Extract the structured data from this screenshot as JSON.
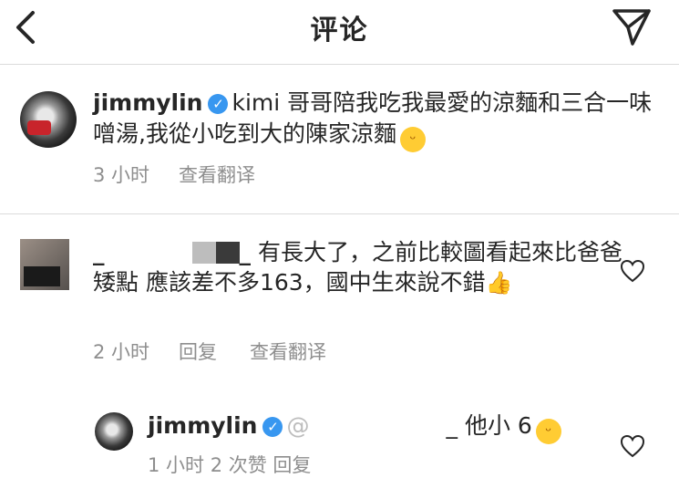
{
  "header": {
    "title": "评论",
    "back_icon": "chevron-left-icon",
    "share_icon": "paper-plane-icon"
  },
  "caption": {
    "username": "jimmylin",
    "text": "kimi 哥哥陪我吃我最愛的涼麵和三合一味噌湯,我從小吃到大的陳家涼麵",
    "emoji": "savoring-face-emoji",
    "time": "3 小时",
    "translate": "查看翻译"
  },
  "comments": [
    {
      "username_prefix": "_",
      "username_suffix": "_",
      "text": "有長大了，之前比較圖看起來比爸爸矮點 應該差不多163，國中生來說不錯",
      "emoji": "thumbs-up-emoji",
      "time": "2 小时",
      "reply": "回复",
      "translate": "查看翻译",
      "reply_item": {
        "username": "jimmylin",
        "mention_prefix": "@",
        "mention_suffix": "_",
        "text": "他小 6",
        "emoji": "smiling-face-emoji",
        "meta_partial": "1 小时   2 次赞   回复"
      }
    }
  ],
  "colors": {
    "text": "#262626",
    "meta": "#8e8e8e",
    "verified": "#3897f0",
    "divider": "#dbdbdb"
  }
}
